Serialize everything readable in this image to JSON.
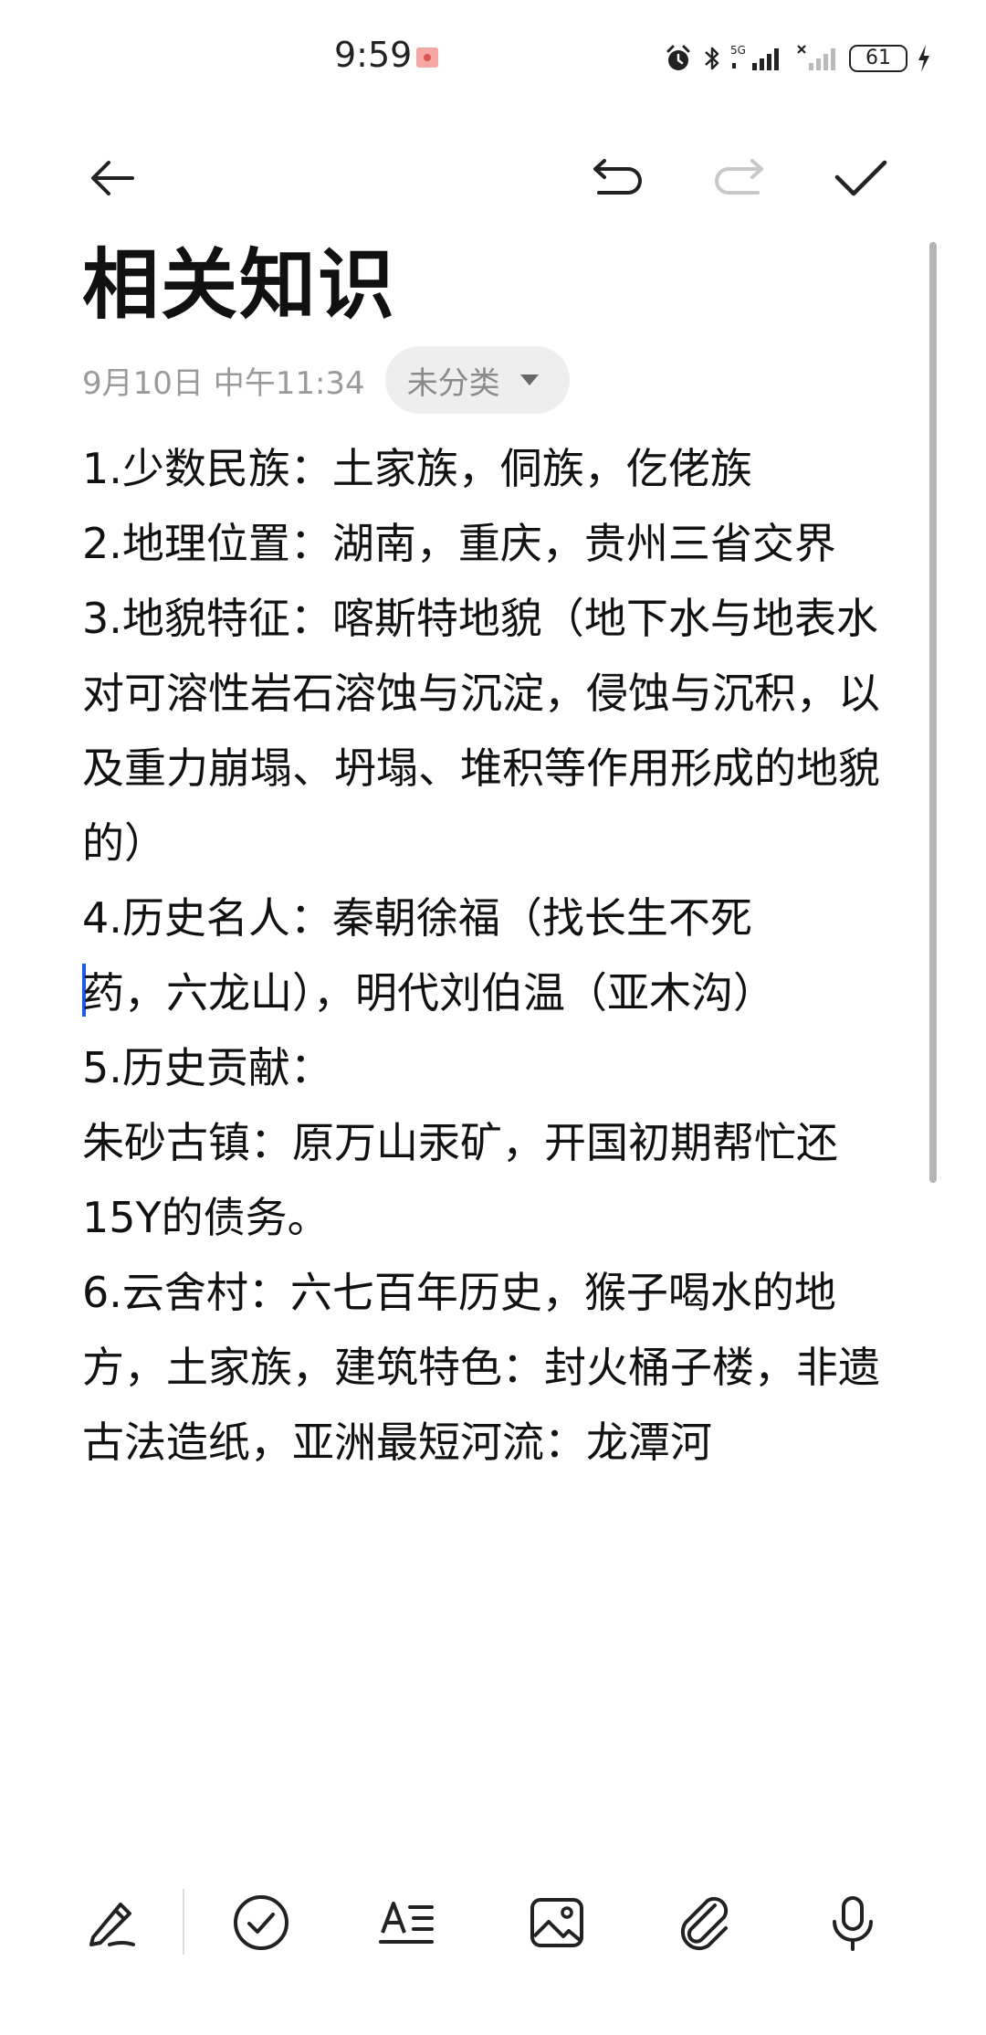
{
  "status_bar": {
    "time": "9:59",
    "network": "5G",
    "battery": "61"
  },
  "toolbar": {
    "back_icon": "arrow-left-icon",
    "undo_icon": "undo-icon",
    "redo_icon": "redo-icon",
    "done_icon": "check-icon",
    "redo_enabled": false
  },
  "note": {
    "title": "相关知识",
    "date": "9月10日 中午11:34",
    "category": "未分类",
    "lines": [
      "1.少数民族：土家族，侗族，仡佬族",
      "2.地理位置：湖南，重庆，贵州三省交界",
      "3.地貌特征：喀斯特地貌（地下水与地表水对可溶性岩石溶蚀与沉淀，侵蚀与沉积，以及重力崩塌、坍塌、堆积等作用形成的地貌的）",
      "4.历史名人：秦朝徐福（找长生不死",
      "药，六龙山），明代刘伯温（亚木沟）",
      "5.历史贡献：",
      "朱砂古镇：原万山汞矿，开国初期帮忙还15Y的债务。",
      "6.云舍村：六七百年历史，猴子喝水的地方，土家族，建筑特色：封火桶子楼，非遗古法造纸，亚洲最短河流：龙潭河"
    ]
  },
  "bottom_toolbar": {
    "items": [
      "pen-icon",
      "checklist-icon",
      "text-style-icon",
      "image-icon",
      "attachment-icon",
      "microphone-icon"
    ]
  },
  "colors": {
    "accent_caret": "#1e57e5",
    "meta_gray": "#9a9a9a",
    "chip_bg": "#eeeeee"
  }
}
